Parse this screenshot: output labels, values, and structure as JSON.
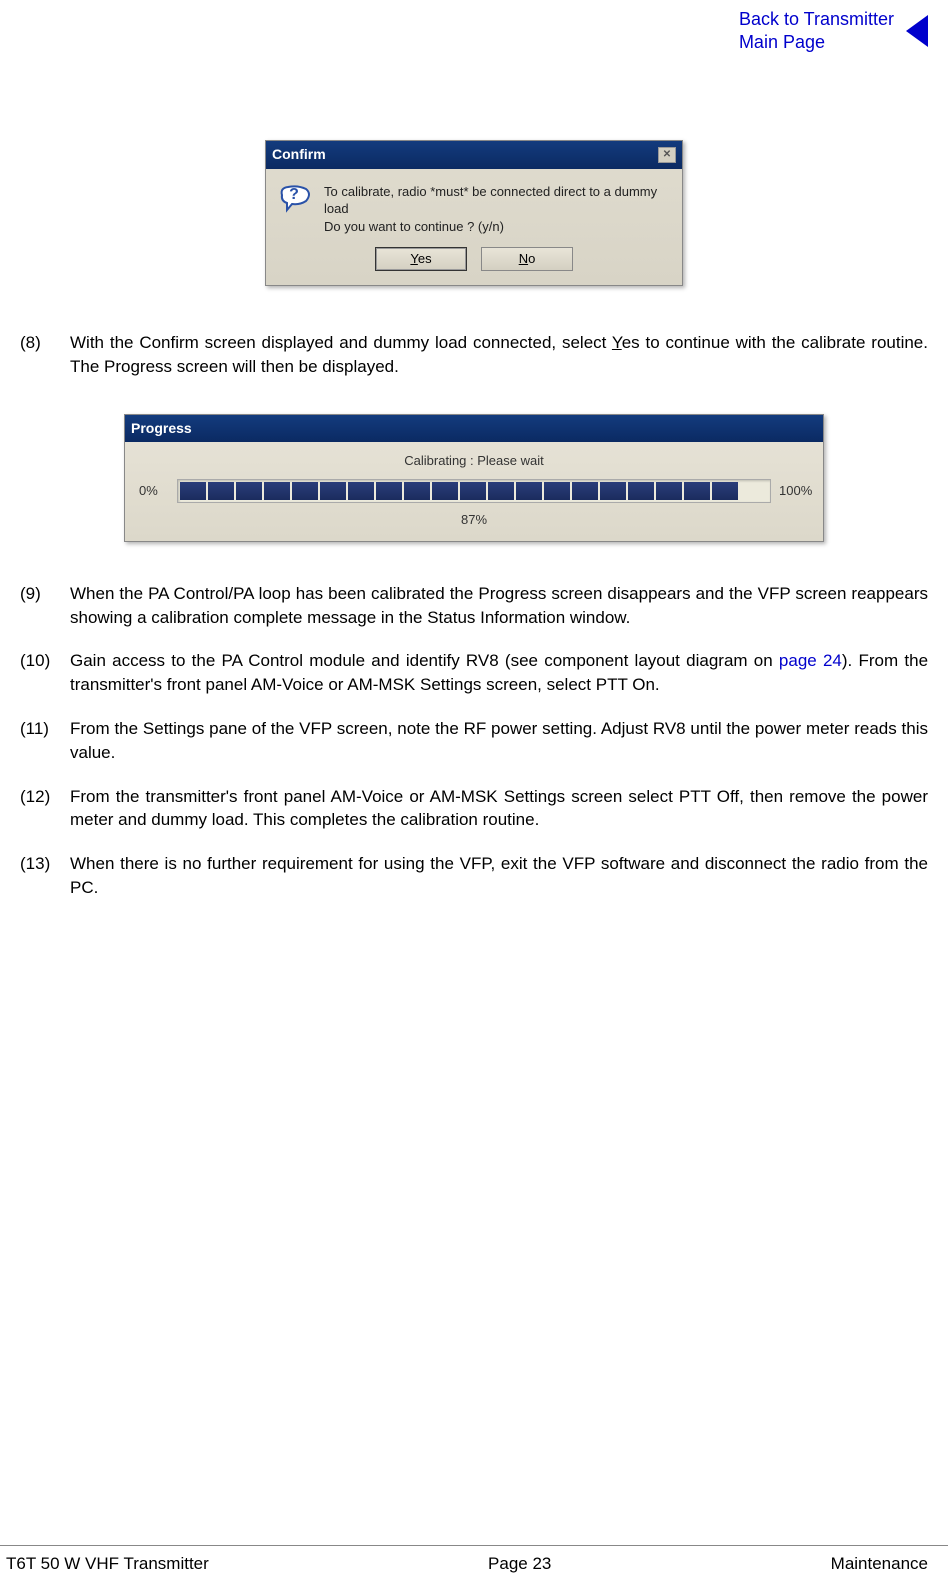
{
  "header": {
    "back_link_line1": "Back to Transmitter",
    "back_link_line2": "Main Page"
  },
  "confirm_dialog": {
    "title": "Confirm",
    "line1": "To calibrate, radio *must* be connected direct to a dummy load",
    "line2": "Do you want to continue ? (y/n)",
    "yes_label": "Yes",
    "no_label": "No",
    "close_glyph": "✕"
  },
  "items": {
    "i8": {
      "num": "(8)",
      "text_before": "With the Confirm screen displayed and dummy load connected, select ",
      "yes_u": "Y",
      "yes_rest": "es to continue with the calibrate routine. The Progress screen will then be displayed."
    },
    "i9": {
      "num": "(9)",
      "text": "When the PA Control/PA loop has been calibrated the Progress screen disappears and the VFP screen reappears showing a calibration complete message in the Status Information window."
    },
    "i10": {
      "num": "(10)",
      "text_before": "Gain access to the PA Control module and identify RV8 (see component layout diagram on ",
      "link": "page 24",
      "text_after": "). From the transmitter's front panel AM-Voice or AM-MSK Settings screen, select PTT On."
    },
    "i11": {
      "num": "(11)",
      "text": "From the Settings pane of the VFP screen, note the RF power setting. Adjust RV8 until the power meter reads this value."
    },
    "i12": {
      "num": "(12)",
      "text": "From the transmitter's front panel AM-Voice or AM-MSK Settings screen select PTT Off, then remove the power meter and dummy load. This completes the calibration routine."
    },
    "i13": {
      "num": "(13)",
      "text": "When there is no further requirement for using the VFP, exit the VFP software and disconnect the radio from the PC."
    }
  },
  "progress_dialog": {
    "title": "Progress",
    "message": "Calibrating : Please wait",
    "left_label": "0%",
    "right_label": "100%",
    "percent": "87%"
  },
  "footer": {
    "left": "T6T 50 W VHF Transmitter",
    "center": "Page 23",
    "right": "Maintenance"
  }
}
